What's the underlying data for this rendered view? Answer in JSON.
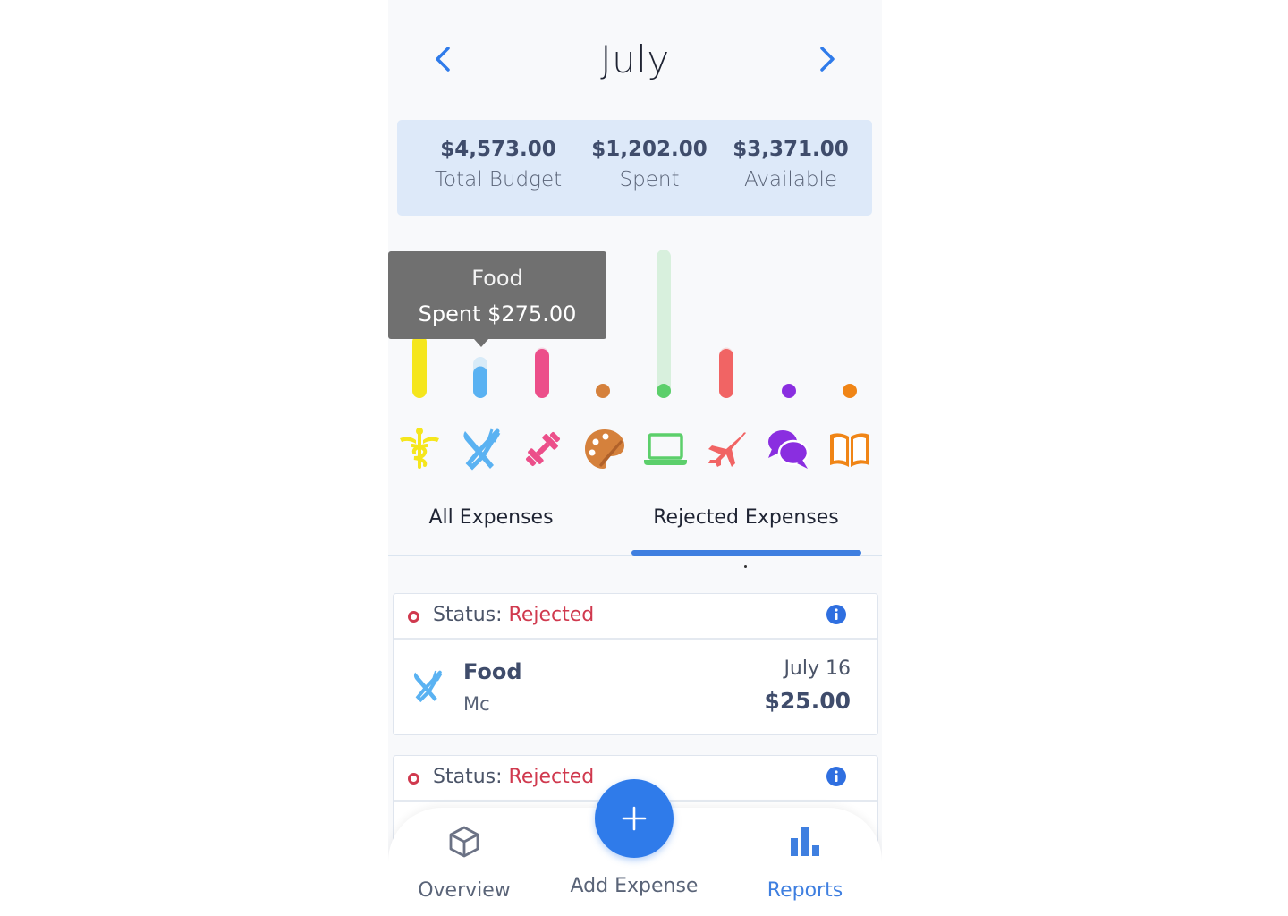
{
  "header": {
    "month": "July"
  },
  "summary": {
    "total_budget_value": "$4,573.00",
    "total_budget_label": "Total Budget",
    "spent_value": "$1,202.00",
    "spent_label": "Spent",
    "available_value": "$3,371.00",
    "available_label": "Available"
  },
  "tooltip": {
    "category": "Food",
    "text": "Spent $275.00"
  },
  "categories": [
    {
      "icon": "medical-caduceus-icon",
      "color": "#f5e61c",
      "level": 0.14
    },
    {
      "icon": "food-utensils-icon",
      "color": "#5ab2f2",
      "level": 0.05
    },
    {
      "icon": "fitness-dumbbell-icon",
      "color": "#ec4f8a",
      "level": 0.1
    },
    {
      "icon": "art-palette-icon",
      "color": "#d5813c",
      "level": 0.0
    },
    {
      "icon": "electronics-laptop-icon",
      "color": "#5ccf6b",
      "level": 0.0
    },
    {
      "icon": "travel-plane-icon",
      "color": "#f16464",
      "level": 0.1
    },
    {
      "icon": "social-chat-icon",
      "color": "#8a2ee0",
      "level": 0.0
    },
    {
      "icon": "education-book-icon",
      "color": "#f08516",
      "level": 0.0
    }
  ],
  "tabs": {
    "all": "All Expenses",
    "rejected": "Rejected Expenses"
  },
  "expenses": [
    {
      "status_label": "Status:",
      "status_value": "Rejected",
      "category": "Food",
      "merchant": "Mc",
      "date": "July 16",
      "amount": "$25.00"
    },
    {
      "status_label": "Status:",
      "status_value": "Rejected"
    }
  ],
  "bottom_nav": {
    "overview": "Overview",
    "add": "Add Expense",
    "reports": "Reports"
  },
  "colors": {
    "accent": "#2f7bea",
    "rejected": "#d0394e",
    "summary_bg": "#dde9f9"
  }
}
